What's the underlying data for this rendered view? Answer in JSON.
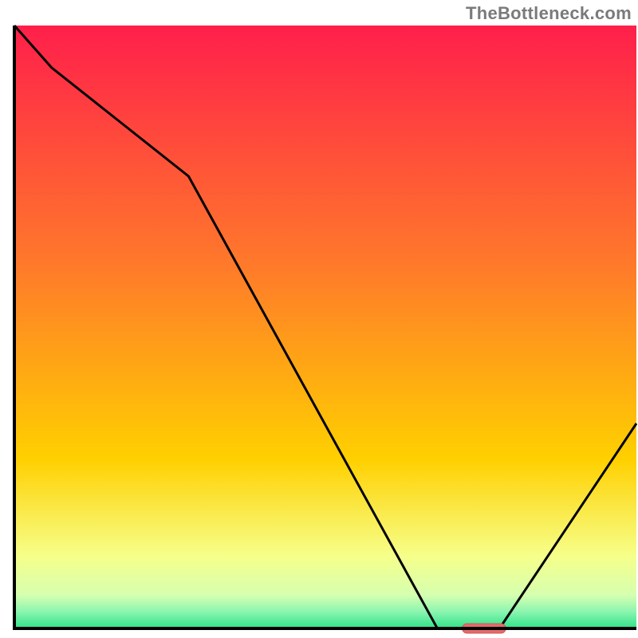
{
  "watermark": "TheBottleneck.com",
  "chart_data": {
    "type": "line",
    "title": "",
    "xlabel": "",
    "ylabel": "",
    "xlim": [
      0,
      100
    ],
    "ylim": [
      0,
      100
    ],
    "x": [
      0,
      6,
      28,
      68,
      74,
      78,
      100
    ],
    "values": [
      100,
      93,
      75,
      0,
      0,
      0,
      34
    ],
    "marker": {
      "x_start": 72,
      "x_end": 79,
      "y": 0
    },
    "background": {
      "stops": [
        {
          "offset": 0,
          "color": "#ff1f4b"
        },
        {
          "offset": 0.4,
          "color": "#ff7a2a"
        },
        {
          "offset": 0.72,
          "color": "#ffd000"
        },
        {
          "offset": 0.88,
          "color": "#f6ff8a"
        },
        {
          "offset": 0.945,
          "color": "#d6ffb0"
        },
        {
          "offset": 0.972,
          "color": "#8cf5b0"
        },
        {
          "offset": 1.0,
          "color": "#2fe38a"
        }
      ]
    },
    "colors": {
      "line": "#000000",
      "marker_fill": "#e46a6a",
      "marker_stroke": "#d15757",
      "axis": "#000000"
    }
  }
}
